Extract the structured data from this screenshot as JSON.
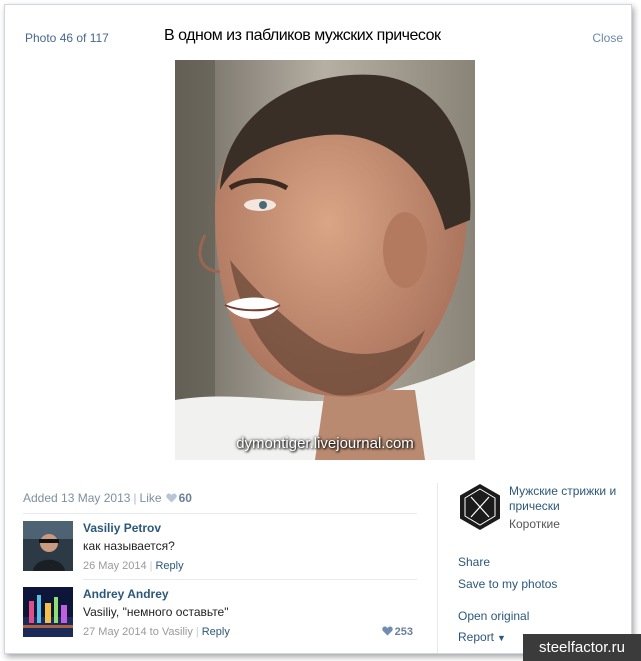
{
  "header": {
    "counter": "Photo 46 of 117",
    "caption": "В одном из пабликов мужских причесок",
    "close_label": "Close"
  },
  "photo": {
    "watermark": "dymontiger.livejournal.com"
  },
  "info": {
    "added": "Added 13 May 2013",
    "like_label": "Like",
    "likes": "60"
  },
  "comments": [
    {
      "author": "Vasiliy Petrov",
      "text": "как называется?",
      "date": "26 May 2014",
      "reply_label": "Reply"
    },
    {
      "author": "Andrey Andrey",
      "text": "Vasiliy, \"немного оставьте\"",
      "date": "27 May 2014 to Vasiliy",
      "reply_label": "Reply",
      "likes": "253"
    }
  ],
  "sidebar": {
    "group_name": "Мужские стрижки и прически",
    "album": "Короткие",
    "share": "Share",
    "save": "Save to my photos",
    "open_original": "Open original",
    "report": "Report"
  },
  "badge": "steelfactor.ru",
  "colors": {
    "link": "#2b587a",
    "muted": "#7f8f9f",
    "heart": "#9fb5cc",
    "badge_bg": "#3b3b3b"
  }
}
